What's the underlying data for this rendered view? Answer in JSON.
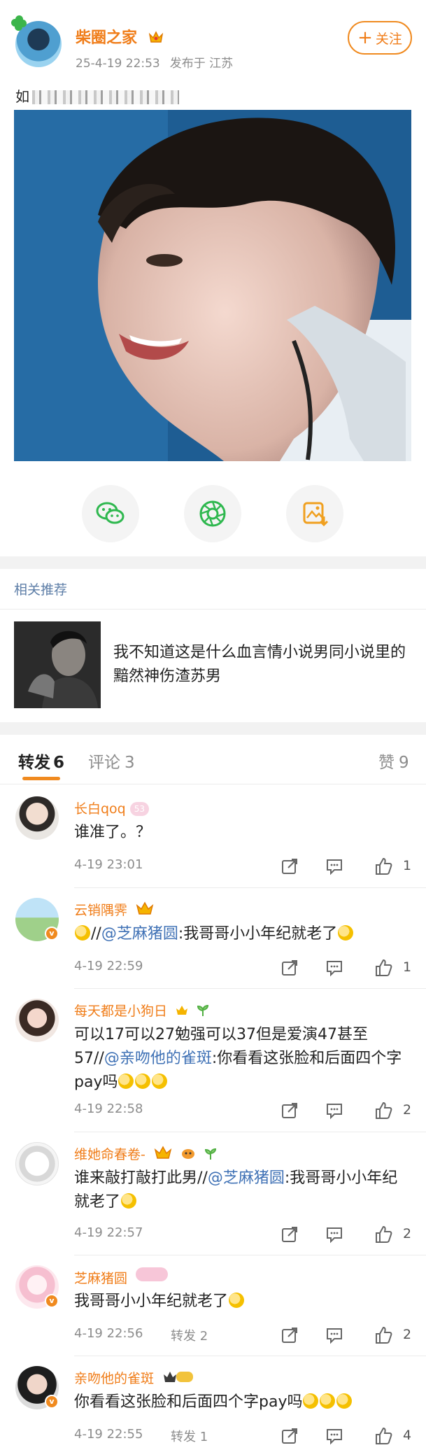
{
  "post": {
    "author": "柴圈之家",
    "timestamp": "25-4-19 22:53",
    "location": "发布于 江苏",
    "follow_label": "关注",
    "text_prefix": "如"
  },
  "share": {
    "icons": [
      "wechat-icon",
      "moments-icon",
      "save-image-icon"
    ]
  },
  "related": {
    "title": "相关推荐",
    "item_text": "我不知道这是什么血言情小说男同小说里的黯然神伤渣苏男"
  },
  "tabs": [
    {
      "label": "转发",
      "count": "6"
    },
    {
      "label": "评论",
      "count": "3"
    },
    {
      "label": "赞",
      "count": "9"
    }
  ],
  "comments": [
    {
      "name": "长白qoq",
      "level": "53",
      "text": "谁准了。？",
      "time": "4-19 23:01",
      "repost": "",
      "likes": "1"
    },
    {
      "name": "云销隅霁",
      "text_pre": "//",
      "mention": "@芝麻猪圆",
      "text_post": ":我哥哥小小年纪就老了",
      "time": "4-19 22:59",
      "repost": "",
      "likes": "1"
    },
    {
      "name": "每天都是小狗日",
      "text_pre": "可以17可以27勉强可以37但是爱演47甚至57//",
      "mention": "@亲吻他的雀斑",
      "text_post": ":你看看这张脸和后面四个字pay吗",
      "time": "4-19 22:58",
      "repost": "",
      "likes": "2"
    },
    {
      "name": "维她命春卷-",
      "text_pre": "谁来敲打敲打此男//",
      "mention": "@芝麻猪圆",
      "text_post": ":我哥哥小小年纪就老了",
      "time": "4-19 22:57",
      "repost": "",
      "likes": "2"
    },
    {
      "name": "芝麻猪圆",
      "text_pre": "我哥哥小小年纪就老了",
      "time": "4-19 22:56",
      "repost": "转发 2",
      "likes": "2"
    },
    {
      "name": "亲吻他的雀斑",
      "text_pre": "你看看这张脸和后面四个字pay吗",
      "time": "4-19 22:55",
      "repost": "转发 1",
      "likes": "4"
    }
  ],
  "colors": {
    "accent": "#f07d19",
    "mention": "#3f71b5",
    "meta": "#8c8c8c"
  }
}
